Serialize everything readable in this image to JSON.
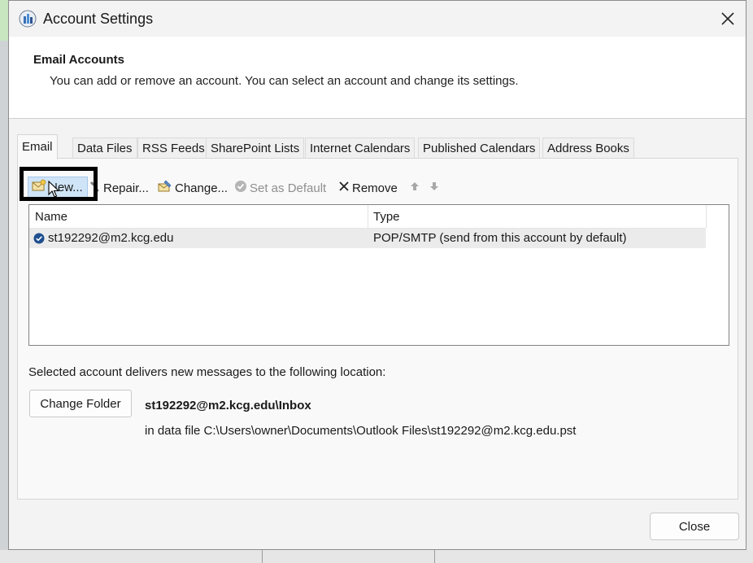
{
  "window": {
    "title": "Account Settings"
  },
  "header": {
    "heading": "Email Accounts",
    "description": "You can add or remove an account. You can select an account and change its settings."
  },
  "tabs": [
    {
      "label": "Email",
      "active": true
    },
    {
      "label": "Data Files"
    },
    {
      "label": "RSS Feeds"
    },
    {
      "label": "SharePoint Lists"
    },
    {
      "label": "Internet Calendars"
    },
    {
      "label": "Published Calendars"
    },
    {
      "label": "Address Books"
    }
  ],
  "toolbar": {
    "new_label": "New...",
    "repair_label": "Repair...",
    "change_label": "Change...",
    "set_default_label": "Set as Default",
    "remove_label": "Remove",
    "move_up_icon": "arrow-up-icon",
    "move_down_icon": "arrow-down-icon"
  },
  "accounts_table": {
    "columns": [
      "Name",
      "Type"
    ],
    "rows": [
      {
        "name": "st192292@m2.kcg.edu",
        "type": "POP/SMTP (send from this account by default)",
        "is_default": true
      }
    ]
  },
  "delivery": {
    "description": "Selected account delivers new messages to the following location:",
    "change_folder_label": "Change Folder",
    "folder": "st192292@m2.kcg.edu\\Inbox",
    "data_file": "in data file C:\\Users\\owner\\Documents\\Outlook Files\\st192292@m2.kcg.edu.pst"
  },
  "footer": {
    "close_label": "Close"
  },
  "colors": {
    "selected_button": "#cfe4f7",
    "row_selected": "#ebebeb",
    "accent_blue": "#1f5fa8",
    "highlight_box": "#000000"
  }
}
